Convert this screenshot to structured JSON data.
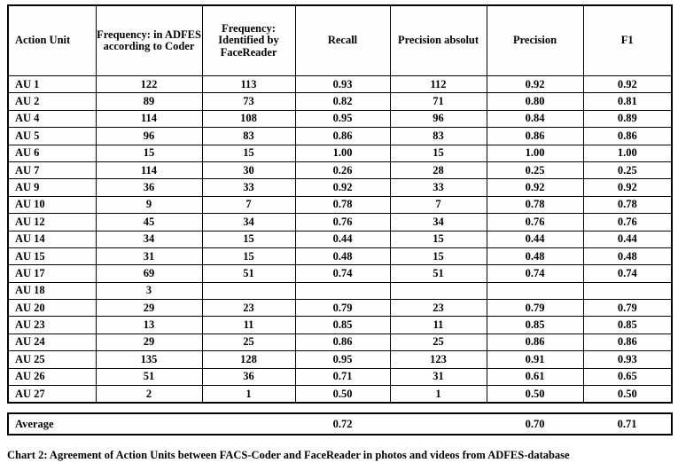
{
  "table": {
    "columns": [
      {
        "key": "action_unit",
        "label": "Action Unit"
      },
      {
        "key": "freq_adfes",
        "label": "Frequency: in ADFES according to Coder"
      },
      {
        "key": "freq_facereader",
        "label": "Frequency: Identified by FaceReader"
      },
      {
        "key": "recall",
        "label": "Recall"
      },
      {
        "key": "precision_absolut",
        "label": "Precision absolut"
      },
      {
        "key": "precision",
        "label": "Precision"
      },
      {
        "key": "f1",
        "label": "F1"
      }
    ],
    "rows": [
      {
        "action_unit": "AU 1",
        "freq_adfes": "122",
        "freq_facereader": "113",
        "recall": "0.93",
        "precision_absolut": "112",
        "precision": "0.92",
        "f1": "0.92"
      },
      {
        "action_unit": "AU 2",
        "freq_adfes": "89",
        "freq_facereader": "73",
        "recall": "0.82",
        "precision_absolut": "71",
        "precision": "0.80",
        "f1": "0.81"
      },
      {
        "action_unit": "AU 4",
        "freq_adfes": "114",
        "freq_facereader": "108",
        "recall": "0.95",
        "precision_absolut": "96",
        "precision": "0.84",
        "f1": "0.89"
      },
      {
        "action_unit": "AU 5",
        "freq_adfes": "96",
        "freq_facereader": "83",
        "recall": "0.86",
        "precision_absolut": "83",
        "precision": "0.86",
        "f1": "0.86"
      },
      {
        "action_unit": "AU 6",
        "freq_adfes": "15",
        "freq_facereader": "15",
        "recall": "1.00",
        "precision_absolut": "15",
        "precision": "1.00",
        "f1": "1.00"
      },
      {
        "action_unit": "AU 7",
        "freq_adfes": "114",
        "freq_facereader": "30",
        "recall": "0.26",
        "precision_absolut": "28",
        "precision": "0.25",
        "f1": "0.25"
      },
      {
        "action_unit": "AU 9",
        "freq_adfes": "36",
        "freq_facereader": "33",
        "recall": "0.92",
        "precision_absolut": "33",
        "precision": "0.92",
        "f1": "0.92"
      },
      {
        "action_unit": "AU 10",
        "freq_adfes": "9",
        "freq_facereader": "7",
        "recall": "0.78",
        "precision_absolut": "7",
        "precision": "0.78",
        "f1": "0.78"
      },
      {
        "action_unit": "AU 12",
        "freq_adfes": "45",
        "freq_facereader": "34",
        "recall": "0.76",
        "precision_absolut": "34",
        "precision": "0.76",
        "f1": "0.76"
      },
      {
        "action_unit": "AU 14",
        "freq_adfes": "34",
        "freq_facereader": "15",
        "recall": "0.44",
        "precision_absolut": "15",
        "precision": "0.44",
        "f1": "0.44"
      },
      {
        "action_unit": "AU 15",
        "freq_adfes": "31",
        "freq_facereader": "15",
        "recall": "0.48",
        "precision_absolut": "15",
        "precision": "0.48",
        "f1": "0.48"
      },
      {
        "action_unit": "AU 17",
        "freq_adfes": "69",
        "freq_facereader": "51",
        "recall": "0.74",
        "precision_absolut": "51",
        "precision": "0.74",
        "f1": "0.74"
      },
      {
        "action_unit": "AU 18",
        "freq_adfes": "3",
        "freq_facereader": "",
        "recall": "",
        "precision_absolut": "",
        "precision": "",
        "f1": ""
      },
      {
        "action_unit": "AU 20",
        "freq_adfes": "29",
        "freq_facereader": "23",
        "recall": "0.79",
        "precision_absolut": "23",
        "precision": "0.79",
        "f1": "0.79"
      },
      {
        "action_unit": "AU 23",
        "freq_adfes": "13",
        "freq_facereader": "11",
        "recall": "0.85",
        "precision_absolut": "11",
        "precision": "0.85",
        "f1": "0.85"
      },
      {
        "action_unit": "AU 24",
        "freq_adfes": "29",
        "freq_facereader": "25",
        "recall": "0.86",
        "precision_absolut": "25",
        "precision": "0.86",
        "f1": "0.86"
      },
      {
        "action_unit": "AU 25",
        "freq_adfes": "135",
        "freq_facereader": "128",
        "recall": "0.95",
        "precision_absolut": "123",
        "precision": "0.91",
        "f1": "0.93"
      },
      {
        "action_unit": "AU 26",
        "freq_adfes": "51",
        "freq_facereader": "36",
        "recall": "0.71",
        "precision_absolut": "31",
        "precision": "0.61",
        "f1": "0.65"
      },
      {
        "action_unit": "AU 27",
        "freq_adfes": "2",
        "freq_facereader": "1",
        "recall": "0.50",
        "precision_absolut": "1",
        "precision": "0.50",
        "f1": "0.50"
      }
    ],
    "average": {
      "label": "Average",
      "freq_adfes": "",
      "freq_facereader": "",
      "recall": "0.72",
      "precision_absolut": "",
      "precision": "0.70",
      "f1": "0.71"
    }
  },
  "caption": {
    "text": "Chart 2: Agreement of Action Units between FACS-Coder and FaceReader in photos and videos from ADFES-database"
  },
  "chart_data": {
    "type": "table",
    "title": "Chart 2: Agreement of Action Units between FACS-Coder and FaceReader in photos and videos from ADFES-database",
    "columns": [
      "Action Unit",
      "Frequency: in ADFES according to Coder",
      "Frequency: Identified by FaceReader",
      "Recall",
      "Precision absolut",
      "Precision",
      "F1"
    ],
    "categories": [
      "AU 1",
      "AU 2",
      "AU 4",
      "AU 5",
      "AU 6",
      "AU 7",
      "AU 9",
      "AU 10",
      "AU 12",
      "AU 14",
      "AU 15",
      "AU 17",
      "AU 18",
      "AU 20",
      "AU 23",
      "AU 24",
      "AU 25",
      "AU 26",
      "AU 27"
    ],
    "series": [
      {
        "name": "Frequency: in ADFES according to Coder",
        "values": [
          122,
          89,
          114,
          96,
          15,
          114,
          36,
          9,
          45,
          34,
          31,
          69,
          3,
          29,
          13,
          29,
          135,
          51,
          2
        ]
      },
      {
        "name": "Frequency: Identified by FaceReader",
        "values": [
          113,
          73,
          108,
          83,
          15,
          30,
          33,
          7,
          34,
          15,
          15,
          51,
          null,
          23,
          11,
          25,
          128,
          36,
          1
        ]
      },
      {
        "name": "Recall",
        "values": [
          0.93,
          0.82,
          0.95,
          0.86,
          1.0,
          0.26,
          0.92,
          0.78,
          0.76,
          0.44,
          0.48,
          0.74,
          null,
          0.79,
          0.85,
          0.86,
          0.95,
          0.71,
          0.5
        ]
      },
      {
        "name": "Precision absolut",
        "values": [
          112,
          71,
          96,
          83,
          15,
          28,
          33,
          7,
          34,
          15,
          15,
          51,
          null,
          23,
          11,
          25,
          123,
          31,
          1
        ]
      },
      {
        "name": "Precision",
        "values": [
          0.92,
          0.8,
          0.84,
          0.86,
          1.0,
          0.25,
          0.92,
          0.78,
          0.76,
          0.44,
          0.48,
          0.74,
          null,
          0.79,
          0.85,
          0.86,
          0.91,
          0.61,
          0.5
        ]
      },
      {
        "name": "F1",
        "values": [
          0.92,
          0.81,
          0.89,
          0.86,
          1.0,
          0.25,
          0.92,
          0.78,
          0.76,
          0.44,
          0.48,
          0.74,
          null,
          0.79,
          0.85,
          0.86,
          0.93,
          0.65,
          0.5
        ]
      }
    ],
    "averages": {
      "Recall": 0.72,
      "Precision": 0.7,
      "F1": 0.71
    },
    "xlabel": "Action Unit",
    "ylabel": "",
    "grid": true,
    "legend": "none"
  }
}
